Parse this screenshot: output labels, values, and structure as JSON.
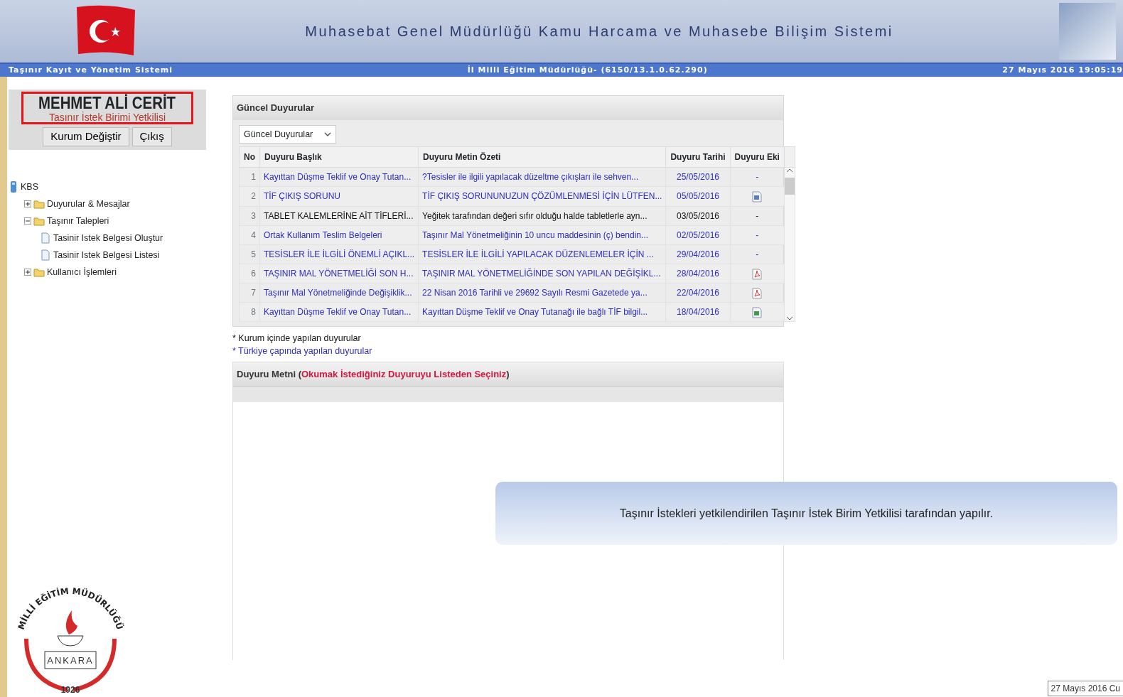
{
  "header": {
    "title": "Muhasebat Genel Müdürlüğü Kamu Harcama ve Muhasebe Bilişim Sistemi",
    "system": "Taşınır Kayıt ve Yönetim Sistemi",
    "institution": "İl Milli Eğitim Müdürlüğü- (6150/13.1.0.62.290)",
    "datetime": "27 Mayıs 2016 19:05:19"
  },
  "user": {
    "name": "MEHMET ALİ CERİT",
    "role": "Tasınır İstek Birimi Yetkilisi",
    "highlighted": true,
    "buttons": [
      "Kurum Değiştir",
      "Çıkış"
    ]
  },
  "tree": [
    {
      "label": "KBS",
      "kind": "root",
      "children": [
        {
          "label": "Duyurular & Mesajlar",
          "kind": "folder",
          "expanded": false
        },
        {
          "label": "Taşınır Talepleri",
          "kind": "folder",
          "expanded": true,
          "children": [
            {
              "label": "Tasinir Istek Belgesi Oluştur",
              "kind": "page"
            },
            {
              "label": "Tasinir Istek Belgesi Listesi",
              "kind": "page"
            }
          ]
        },
        {
          "label": "Kullanıcı İşlemleri",
          "kind": "folder",
          "expanded": false
        }
      ]
    }
  ],
  "logo": {
    "arc_text": "MİLLİ EĞİTİM MÜDÜRLÜĞÜ",
    "city": "ANKARA",
    "year": "1926"
  },
  "announcements": {
    "title": "Güncel Duyurular",
    "filter": "Güncel Duyurular",
    "columns": [
      "No",
      "Duyuru Başlık",
      "Duyuru Metin Özeti",
      "Duyuru Tarihi",
      "Duyuru Eki"
    ],
    "rows": [
      {
        "no": "1",
        "title": "Kayıttan Düşme Teklif ve Onay Tutan...",
        "summary": "?Tesisler ile ilgili yapılacak düzeltme çıkışları ile sehven...",
        "date": "25/05/2016",
        "color": "#2c2cc0",
        "kind": "dash",
        "attachment_text": "-"
      },
      {
        "no": "2",
        "title": "TİF ÇIKIŞ SORUNU",
        "summary": "TİF ÇIKIŞ SORUNUNUZUN ÇÖZÜMLENMESİ İÇİN LÜTFEN...",
        "date": "05/05/2016",
        "color": "#2c2cc0",
        "kind": "word"
      },
      {
        "no": "3",
        "title": "TABLET KALEMLERİNE AİT TİFLERİ...",
        "summary": "Yeğitek tarafından değeri sıfır olduğu halde tabletlerle ayn...",
        "date": "03/05/2016",
        "color": "#111111",
        "kind": "dash",
        "attachment_text": "-"
      },
      {
        "no": "4",
        "title": "Ortak Kullanım Teslim Belgeleri",
        "summary": "Taşınır Mal Yönetmeliğinin 10 uncu maddesinin (ç) bendin...",
        "date": "02/05/2016",
        "color": "#2c2cc0",
        "kind": "dash",
        "attachment_text": "-"
      },
      {
        "no": "5",
        "title": "TESİSLER İLE İLGİLİ ÖNEMLİ AÇIKL...",
        "summary": "TESİSLER İLE İLGİLİ YAPILACAK DÜZENLEMELER İÇİN ...",
        "date": "29/04/2016",
        "color": "#2c2cc0",
        "kind": "dash",
        "attachment_text": "-"
      },
      {
        "no": "6",
        "title": "TAŞINIR MAL YÖNETMELİĞİ SON H...",
        "summary": "TAŞINIR MAL YÖNETMELİĞİNDE SON YAPILAN DEĞİŞİKL...",
        "date": "28/04/2016",
        "color": "#2c2cc0",
        "kind": "pdf"
      },
      {
        "no": "7",
        "title": "Taşınır Mal Yönetmeliğinde Değişiklik...",
        "summary": "22 Nisan 2016 Tarihli ve 29692 Sayılı Resmi Gazetede ya...",
        "date": "22/04/2016",
        "color": "#2c2cc0",
        "kind": "pdf"
      },
      {
        "no": "8",
        "title": "Kayıttan Düşme Teklif ve Onay Tutan...",
        "summary": "Kayıttan Düşme Teklif ve Onay Tutanağı ile bağlı TİF bilgil...",
        "date": "18/04/2016",
        "color": "#2c2cc0",
        "kind": "excel"
      }
    ],
    "legend": [
      {
        "text": "* Kurum içinde yapılan duyurular",
        "color": "#111111"
      },
      {
        "text": "* Türkiye çapında yapılan duyurular",
        "color": "#2c2cc0"
      }
    ]
  },
  "announcement_text": {
    "label": "Duyuru Metni (",
    "hint": "Okumak İstediğiniz Duyuruyu Listeden Seçiniz",
    "close": ")"
  },
  "callout": "Taşınır İstekleri yetkilendirilen Taşınır İstek Birim Yetkilisi tarafından yapılır.",
  "footer_date": "27 Mayıs 2016 Cu"
}
